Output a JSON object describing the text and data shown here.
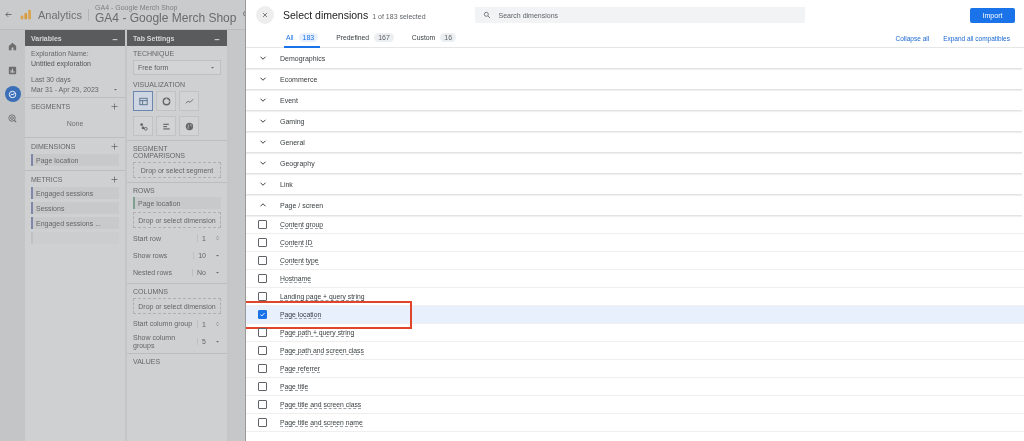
{
  "app_bar": {
    "product": "Analytics",
    "account": "GA4 - Google Merch Shop",
    "property": "GA4 - Google Merch Shop"
  },
  "nav": [
    {
      "kind": "home",
      "selected": false
    },
    {
      "kind": "reports",
      "selected": false
    },
    {
      "kind": "explore",
      "selected": true
    },
    {
      "kind": "advertising",
      "selected": false
    }
  ],
  "variables": {
    "title": "Variables",
    "name_label": "Exploration Name:",
    "name": "Untitled exploration",
    "date_label": "Last 30 days",
    "date_range": "Mar 31 - Apr 29, 2023",
    "segments": {
      "title": "SEGMENTS",
      "empty": "None"
    },
    "dimensions": {
      "title": "DIMENSIONS",
      "items": [
        "Page location"
      ]
    },
    "metrics": {
      "title": "METRICS",
      "items": [
        {
          "kind": "chip",
          "label": "Engaged sessions"
        },
        {
          "kind": "chip",
          "label": "Sessions"
        },
        {
          "kind": "chip",
          "label": "Engaged sessions ..."
        },
        {
          "kind": "ghost"
        }
      ]
    }
  },
  "tab_settings": {
    "title": "Tab Settings",
    "technique": {
      "title": "TECHNIQUE",
      "value": "Free form"
    },
    "visualization": {
      "title": "VISUALIZATION",
      "options": [
        {
          "kind": "table",
          "selected": true
        },
        {
          "kind": "donut",
          "selected": false
        },
        {
          "kind": "line",
          "selected": false
        },
        {
          "kind": "scatter",
          "selected": false
        },
        {
          "kind": "bar",
          "selected": false
        },
        {
          "kind": "geo",
          "selected": false
        }
      ]
    },
    "segment_comparisons": {
      "title": "SEGMENT COMPARISONS",
      "drop": "Drop or select segment"
    },
    "rows": {
      "title": "ROWS",
      "items": [
        "Page location"
      ],
      "drop": "Drop or select dimension",
      "settings": [
        {
          "kind": "stepper",
          "label": "Start row",
          "value": "1"
        },
        {
          "kind": "select",
          "label": "Show rows",
          "value": "10"
        },
        {
          "kind": "select",
          "label": "Nested rows",
          "value": "No"
        }
      ]
    },
    "columns": {
      "title": "COLUMNS",
      "drop": "Drop or select dimension",
      "settings": [
        {
          "kind": "stepper",
          "label": "Start column group",
          "value": "1"
        },
        {
          "kind": "select",
          "label": "Show column groups",
          "value": "5"
        }
      ]
    },
    "values": {
      "title": "VALUES"
    }
  },
  "dialog": {
    "title": "Select dimensions",
    "selection_count": "1 of 183 selected",
    "search": {
      "placeholder": "Search dimensions"
    },
    "import_button": "Import",
    "tabs": [
      {
        "label": "All",
        "count": "183",
        "selected": true
      },
      {
        "label": "Predefined",
        "count": "167",
        "selected": false
      },
      {
        "label": "Custom",
        "count": "16",
        "selected": false
      }
    ],
    "actions": [
      "Collapse all",
      "Expand all compatibles"
    ],
    "categories": [
      {
        "label": "Demographics",
        "expanded": false
      },
      {
        "label": "Ecommerce",
        "expanded": false
      },
      {
        "label": "Event",
        "expanded": false
      },
      {
        "label": "Gaming",
        "expanded": false
      },
      {
        "label": "General",
        "expanded": false
      },
      {
        "label": "Geography",
        "expanded": false
      },
      {
        "label": "Link",
        "expanded": false
      },
      {
        "label": "Page / screen",
        "expanded": true,
        "children": [
          {
            "label": "Content group",
            "checked": false,
            "highlighted": false
          },
          {
            "label": "Content ID",
            "checked": false,
            "highlighted": false
          },
          {
            "label": "Content type",
            "checked": false,
            "highlighted": false
          },
          {
            "label": "Hostname",
            "checked": false,
            "highlighted": false
          },
          {
            "label": "Landing page + query string",
            "checked": false,
            "highlighted": false
          },
          {
            "label": "Page location",
            "checked": true,
            "highlighted": true
          },
          {
            "label": "Page path + query string",
            "checked": false,
            "highlighted": false
          },
          {
            "label": "Page path and screen class",
            "checked": false,
            "highlighted": false
          },
          {
            "label": "Page referrer",
            "checked": false,
            "highlighted": false
          },
          {
            "label": "Page title",
            "checked": false,
            "highlighted": false
          },
          {
            "label": "Page title and screen class",
            "checked": false,
            "highlighted": false
          },
          {
            "label": "Page title and screen name",
            "checked": false,
            "highlighted": false
          }
        ]
      }
    ]
  }
}
